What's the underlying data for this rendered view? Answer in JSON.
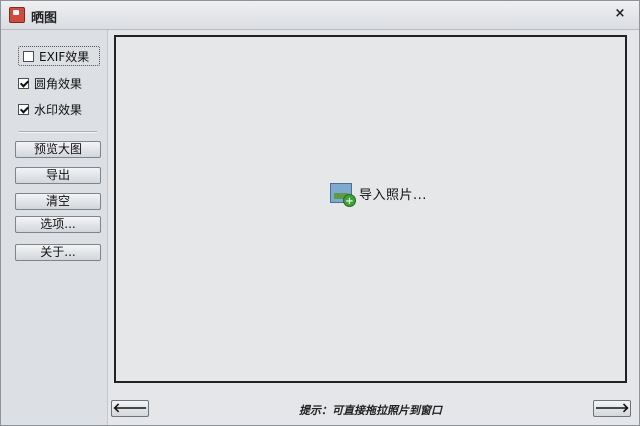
{
  "window": {
    "title": "晒图",
    "close_glyph": "×"
  },
  "sidebar": {
    "checkboxes": [
      {
        "label": "EXIF效果",
        "checked": false
      },
      {
        "label": "圆角效果",
        "checked": true
      },
      {
        "label": "水印效果",
        "checked": true
      }
    ],
    "buttons": [
      {
        "label": "预览大图"
      },
      {
        "label": "导出"
      },
      {
        "label": "清空"
      },
      {
        "label": "选项..."
      },
      {
        "label": "关于..."
      }
    ]
  },
  "canvas": {
    "import_label": "导入照片..."
  },
  "bottom": {
    "prev_glyph": "🡐",
    "next_glyph": "🡒",
    "hint": "提示：可直接拖拉照片到窗口"
  },
  "icons": {
    "app": "app-icon",
    "photo": "add-photo-icon",
    "prev": "arrow-left-icon",
    "next": "arrow-right-icon"
  }
}
